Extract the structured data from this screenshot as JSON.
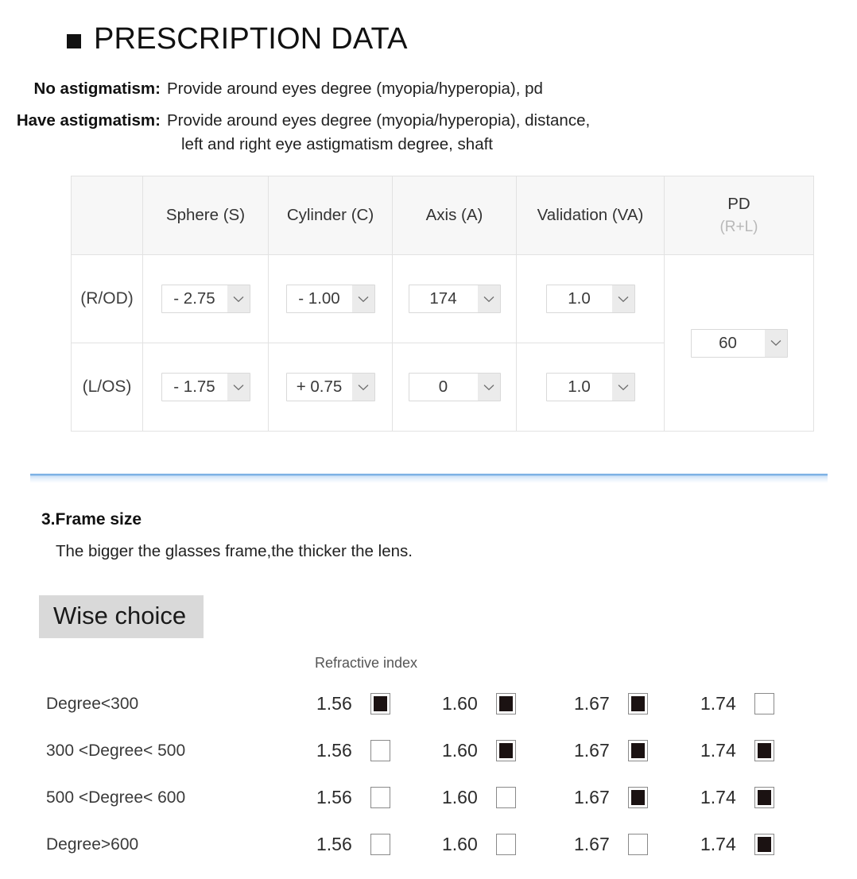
{
  "header": {
    "title": "PRESCRIPTION DATA",
    "bullet_icon": "filled-square-bullet-icon"
  },
  "intro": [
    {
      "label": "No astigmatism:",
      "text": "Provide around eyes degree (myopia/hyperopia), pd",
      "line2": ""
    },
    {
      "label": "Have astigmatism:",
      "text": "Provide around eyes degree (myopia/hyperopia), distance,",
      "line2": "left and right eye astigmatism degree, shaft"
    }
  ],
  "prescription_table": {
    "headers": {
      "eye": "",
      "sphere": "Sphere (S)",
      "cylinder": "Cylinder (C)",
      "axis": "Axis (A)",
      "validation": "Validation (VA)",
      "pd_main": "PD",
      "pd_sub": "(R+L)"
    },
    "rows": [
      {
        "eye": "(R/OD)",
        "sphere": "- 2.75",
        "cylinder": "- 1.00",
        "axis": "174",
        "validation": "1.0"
      },
      {
        "eye": "(L/OS)",
        "sphere": "- 1.75",
        "cylinder": "+ 0.75",
        "axis": "0",
        "validation": "1.0"
      }
    ],
    "pd_value": "60"
  },
  "frame_size": {
    "title": "3.Frame size",
    "body": "The bigger the glasses frame,the thicker the lens."
  },
  "wise_choice": {
    "heading": "Wise choice",
    "refractive_index_label": "Refractive index",
    "columns": [
      "1.56",
      "1.60",
      "1.67",
      "1.74"
    ],
    "rows": [
      {
        "label": "Degree<300",
        "checked": [
          true,
          true,
          true,
          false
        ]
      },
      {
        "label": "300 <Degree< 500",
        "checked": [
          false,
          true,
          true,
          true
        ]
      },
      {
        "label": "500 <Degree< 600",
        "checked": [
          false,
          false,
          true,
          true
        ]
      },
      {
        "label": "Degree>600",
        "checked": [
          false,
          false,
          false,
          true
        ]
      }
    ]
  },
  "colors": {
    "divider_blue": "#7fb2e5",
    "header_bg": "#f7f7f7",
    "highlight_bg": "#d9d9d9",
    "checkbox_fill": "#1b1212"
  }
}
